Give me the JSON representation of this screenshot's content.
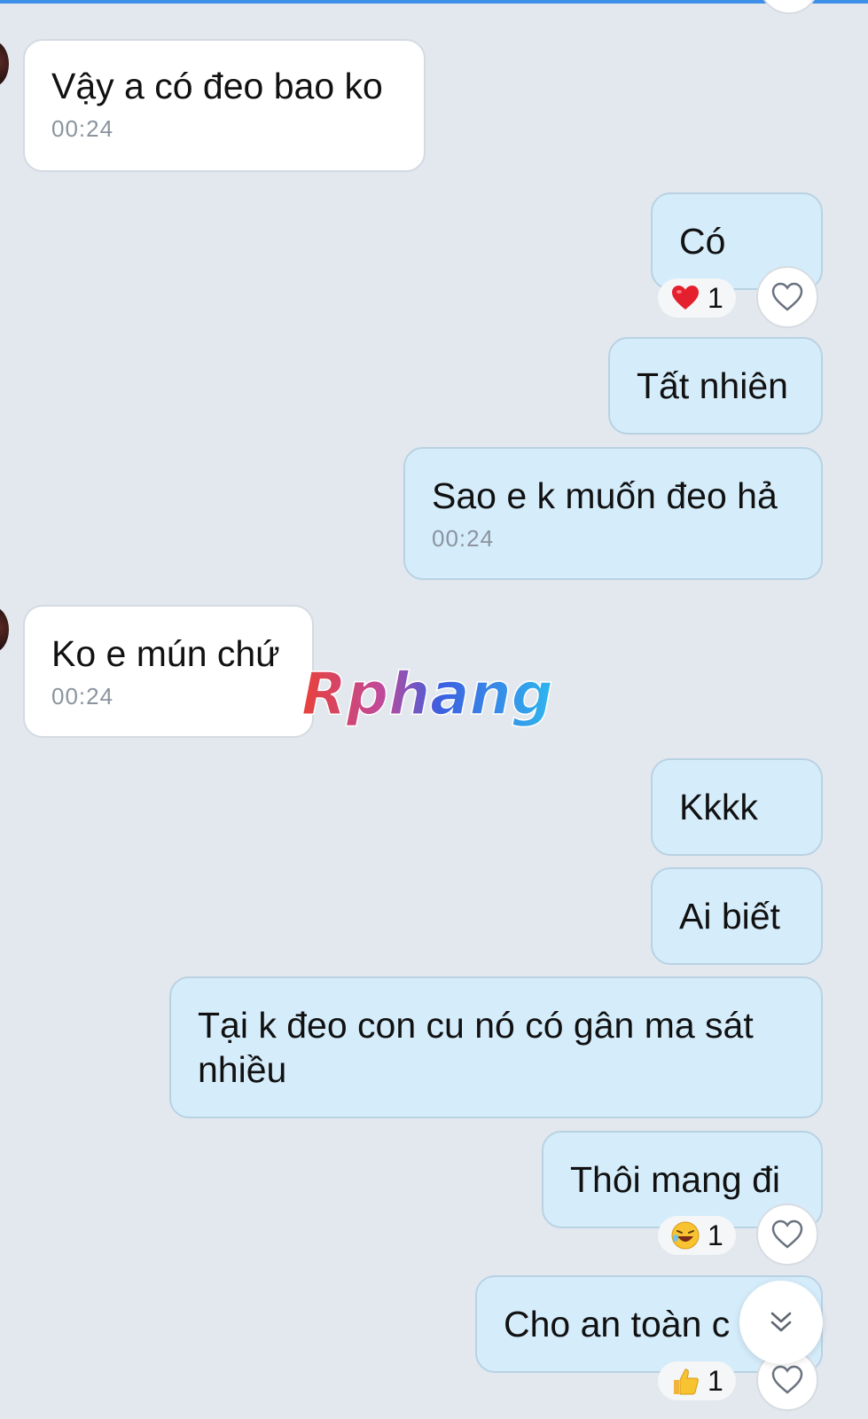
{
  "watermark": {
    "text": "Rphang"
  },
  "messages": [
    {
      "id": "m1",
      "direction": "in",
      "text": "Vậy a có đeo bao ko",
      "time": "00:24"
    },
    {
      "id": "m2",
      "direction": "out",
      "text": "Có",
      "reaction": {
        "emoji": "red-heart",
        "count": "1"
      }
    },
    {
      "id": "m3",
      "direction": "out",
      "text": "Tất nhiên"
    },
    {
      "id": "m4",
      "direction": "out",
      "text": "Sao e k muốn đeo hả",
      "time": "00:24"
    },
    {
      "id": "m5",
      "direction": "in",
      "text": "Ko e mún chứ",
      "time": "00:24"
    },
    {
      "id": "m6",
      "direction": "out",
      "text": "Kkkk"
    },
    {
      "id": "m7",
      "direction": "out",
      "text": "Ai biết"
    },
    {
      "id": "m8",
      "direction": "out",
      "text": "Tại k đeo con cu nó có gân ma sát nhiều"
    },
    {
      "id": "m9",
      "direction": "out",
      "text": "Thôi mang đi",
      "reaction": {
        "emoji": "laughing-face",
        "count": "1"
      }
    },
    {
      "id": "m10",
      "direction": "out",
      "text": "Cho an toàn c",
      "reaction": {
        "emoji": "thumbs-up",
        "count": "1"
      }
    }
  ],
  "icons": {
    "react": "heart-outline-icon",
    "scroll": "double-chevron-down-icon"
  },
  "colors": {
    "background": "#e3e8ef",
    "incoming_bubble": "#ffffff",
    "outgoing_bubble": "#d5ecfb",
    "timestamp": "#8b949e",
    "accent": "#3d8fe8"
  }
}
